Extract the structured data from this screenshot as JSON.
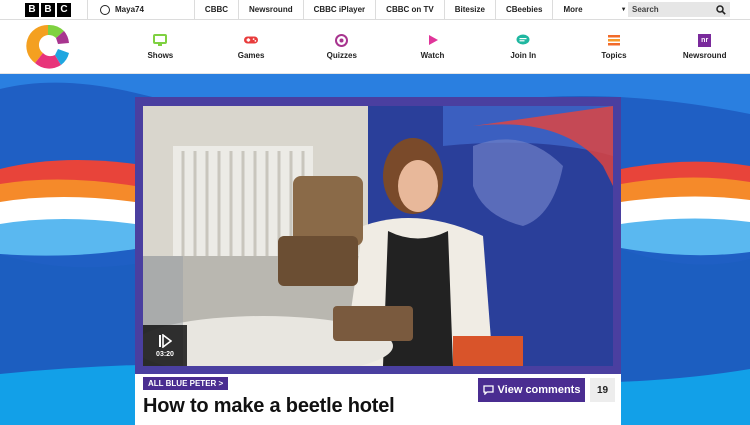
{
  "bbc_bar": {
    "logo_letters": [
      "B",
      "B",
      "C"
    ],
    "account_label": "Maya74",
    "nav_items": [
      "CBBC",
      "Newsround",
      "CBBC iPlayer",
      "CBBC on TV",
      "Bitesize",
      "CBeebies"
    ],
    "more_label": "More",
    "search_placeholder": "Search"
  },
  "cbbc_nav": {
    "items": [
      {
        "label": "Shows",
        "icon": "tv-icon",
        "color": "#7fd141"
      },
      {
        "label": "Games",
        "icon": "gamepad-icon",
        "color": "#e83c3c"
      },
      {
        "label": "Quizzes",
        "icon": "quiz-icon",
        "color": "#a8358f"
      },
      {
        "label": "Watch",
        "icon": "play-icon",
        "color": "#e0359a"
      },
      {
        "label": "Join In",
        "icon": "chat-icon",
        "color": "#1fb7a0"
      },
      {
        "label": "Topics",
        "icon": "topics-icon",
        "color": "#f26b2a"
      },
      {
        "label": "Newsround",
        "icon": "newsround-icon",
        "color": "#7a2a9c",
        "badge": "nr"
      }
    ]
  },
  "video": {
    "duration": "03:20",
    "tag": "ALL BLUE PETER >",
    "title": "How to make a beetle hotel",
    "comments_label": "View comments",
    "comments_count": "19"
  },
  "colors": {
    "hero_blue": "#1c6fd0",
    "purple": "#4a2d91",
    "frame_purple": "#4a3fa0"
  }
}
